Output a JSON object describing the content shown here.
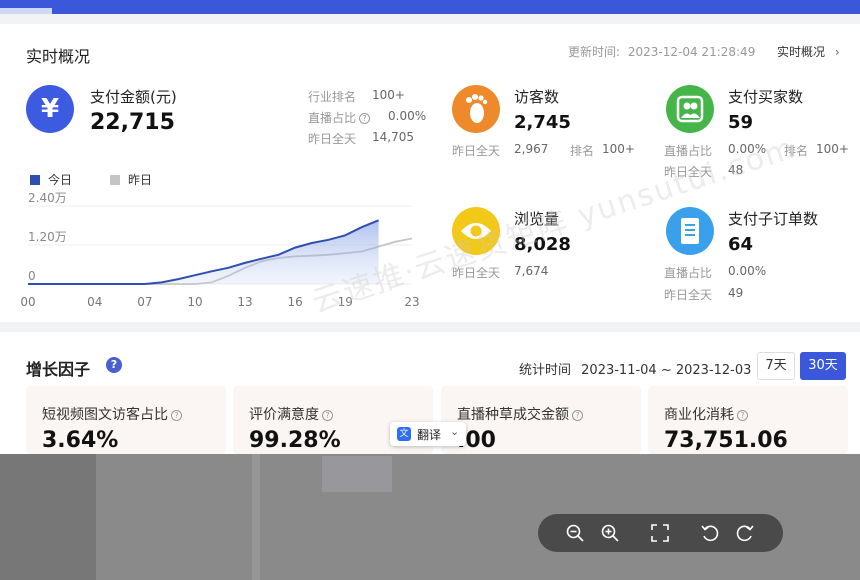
{
  "realtime": {
    "title": "实时概况",
    "update_label": "更新时间:",
    "update_time": "2023-12-04 21:28:49",
    "link": "实时概况"
  },
  "payment": {
    "label": "支付金额(元)",
    "value": "22,715",
    "rank_label": "行业排名",
    "rank_value": "100+",
    "live_label": "直播占比",
    "live_value": "0.00%",
    "yesterday_label": "昨日全天",
    "yesterday_value": "14,705"
  },
  "chart_data": {
    "type": "area",
    "legend": [
      "今日",
      "昨日"
    ],
    "x_ticks": [
      "00",
      "04",
      "07",
      "10",
      "13",
      "16",
      "19",
      "23"
    ],
    "y_ticks": [
      "0",
      "1.20万",
      "2.40万"
    ],
    "ylim": [
      0,
      24000
    ],
    "legend_position": "top-left",
    "series": [
      {
        "name": "今日",
        "x": [
          0,
          1,
          2,
          3,
          4,
          5,
          6,
          7,
          8,
          9,
          10,
          11,
          12,
          13,
          14,
          15,
          16,
          17,
          18,
          19,
          20,
          21
        ],
        "values": [
          0,
          0,
          0,
          0,
          0,
          0,
          0,
          0,
          500,
          1500,
          2700,
          3900,
          5000,
          6500,
          7800,
          9000,
          11200,
          12600,
          13600,
          15000,
          17500,
          19600
        ]
      },
      {
        "name": "昨日",
        "x": [
          0,
          1,
          2,
          3,
          4,
          5,
          6,
          7,
          8,
          9,
          10,
          11,
          12,
          13,
          14,
          15,
          16,
          17,
          18,
          19,
          20,
          21,
          22,
          23
        ],
        "values": [
          0,
          0,
          0,
          0,
          0,
          0,
          0,
          0,
          0,
          0,
          0,
          500,
          2500,
          5000,
          7000,
          8000,
          8500,
          8700,
          9000,
          9500,
          10000,
          11500,
          13000,
          14000
        ]
      }
    ],
    "colors": [
      "#2f4fb0",
      "#c4c4c4"
    ]
  },
  "visitors": {
    "label": "访客数",
    "value": "2,745",
    "yesterday_label": "昨日全天",
    "yesterday_value": "2,967",
    "rank_label": "排名",
    "rank_value": "100+"
  },
  "buyers": {
    "label": "支付买家数",
    "value": "59",
    "live_label": "直播占比",
    "live_value": "0.00%",
    "rank_label": "排名",
    "rank_value": "100+",
    "yesterday_label": "昨日全天",
    "yesterday_value": "48"
  },
  "pageviews": {
    "label": "浏览量",
    "value": "8,028",
    "yesterday_label": "昨日全天",
    "yesterday_value": "7,674"
  },
  "orders": {
    "label": "支付子订单数",
    "value": "64",
    "live_label": "直播占比",
    "live_value": "0.00%",
    "yesterday_label": "昨日全天",
    "yesterday_value": "49"
  },
  "growth": {
    "title": "增长因子",
    "stat_label": "统计时间",
    "stat_range": "2023-11-04 ~ 2023-12-03",
    "btn_7": "7天",
    "btn_30": "30天",
    "cards": [
      {
        "label": "短视频图文访客占比",
        "value": "3.64%"
      },
      {
        "label": "评价满意度",
        "value": "99.28%"
      },
      {
        "label": "直播种草成交金额",
        "value": ".00"
      },
      {
        "label": "商业化消耗",
        "value": "73,751.06"
      }
    ]
  },
  "translate": {
    "label": "翻译"
  },
  "watermark": {
    "text": "云速推·云速货矩阵 yunsutui.com"
  },
  "colors": {
    "brand": "#3a58d9",
    "payment_icon": "#3c5be0",
    "visitors_icon": "#ef8a2c",
    "buyers_icon": "#45b549",
    "pageviews_icon": "#f2c919",
    "orders_icon": "#3aa0ec"
  }
}
